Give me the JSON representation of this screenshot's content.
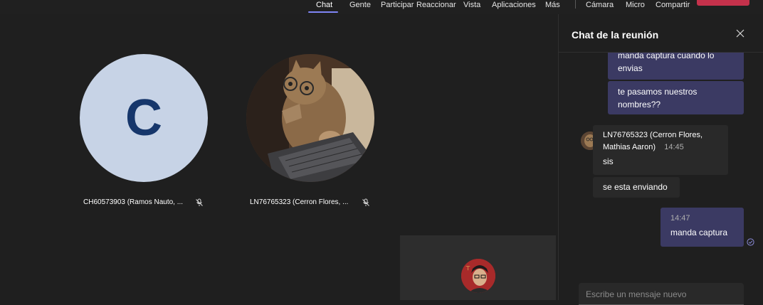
{
  "toolbar": {
    "items": [
      {
        "label": "Chat"
      },
      {
        "label": "Gente"
      },
      {
        "label": "Participar"
      },
      {
        "label": "Reaccionar"
      },
      {
        "label": "Vista"
      },
      {
        "label": "Aplicaciones"
      },
      {
        "label": "Más"
      },
      {
        "label": "Cámara"
      },
      {
        "label": "Micro"
      },
      {
        "label": "Compartir"
      }
    ],
    "active": "Chat"
  },
  "stage": {
    "participants": [
      {
        "initial": "C",
        "name": "CH60573903 (Ramos Nauto, ..."
      },
      {
        "name": "LN76765323 (Cerron Flores, ..."
      }
    ]
  },
  "chat": {
    "title": "Chat de la reunión",
    "messages": [
      {
        "text_line1": "manda captura cuando lo",
        "text_line2": "envias"
      },
      {
        "text_line1": "te pasamos nuestros",
        "text_line2": "nombres??"
      },
      {
        "sender_line1": "LN76765323 (Cerron Flores,",
        "sender_line2": "Mathias Aaron)",
        "time": "14:45",
        "text": "sis"
      },
      {
        "text": "se esta enviando"
      },
      {
        "time": "14:47",
        "text": "manda captura"
      }
    ],
    "compose_placeholder": "Escribe un mensaje nuevo"
  },
  "colors": {
    "accent": "#7f85f5",
    "own_bubble": "#3b3a63",
    "other_bubble": "#292929",
    "leave": "#c4314b",
    "avatar_bg": "#c7d3e6",
    "avatar_text": "#16366b"
  },
  "icons": [
    "mic-off-icon",
    "close-icon",
    "read-receipt-icon",
    "presence-busy-icon"
  ]
}
